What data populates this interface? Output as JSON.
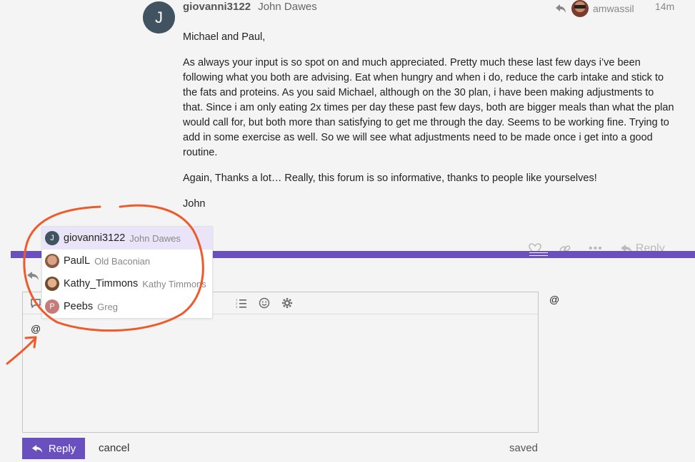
{
  "post": {
    "avatar_letter": "J",
    "username": "giovanni3122",
    "full_name": "John Dawes",
    "reply_to_user": "amwassil",
    "time": "14m",
    "paragraphs": [
      "Michael and Paul,",
      "As always your input is so spot on and much appreciated. Pretty much these last few days i’ve been following what you both are advising. Eat when hungry and when i do, reduce the carb intake and stick to the fats and proteins. As you said Michael, although on the 30 plan, i have been making adjustments to that. Since i am only eating 2x times per day these past few days, both are bigger meals than what the plan would call for, but both more than satisfying to get me through the day. Seems to be working fine. Trying to add in some exercise as well. So we will see what adjustments need to be made once i get into a good routine.",
      "Again, Thanks a lot… Really, this forum is so informative, thanks to people like yourselves!",
      "John"
    ],
    "actions": {
      "reply_label": "Reply"
    }
  },
  "composer": {
    "editor_text": "@",
    "preview_text": "@",
    "submit_label": "Reply",
    "cancel_label": "cancel",
    "status": "saved"
  },
  "autocomplete": {
    "items": [
      {
        "username": "giovanni3122",
        "name": "John Dawes",
        "avatar_letter": "J"
      },
      {
        "username": "PaulL",
        "name": "Old Baconian",
        "avatar_letter": ""
      },
      {
        "username": "Kathy_Timmons",
        "name": "Kathy Timmons",
        "avatar_letter": ""
      },
      {
        "username": "Peebs",
        "name": "Greg",
        "avatar_letter": "P"
      }
    ]
  },
  "colors": {
    "accent": "#6a4fbf",
    "annotation": "#ef5a2a",
    "selected_row": "#e9e4f7"
  }
}
